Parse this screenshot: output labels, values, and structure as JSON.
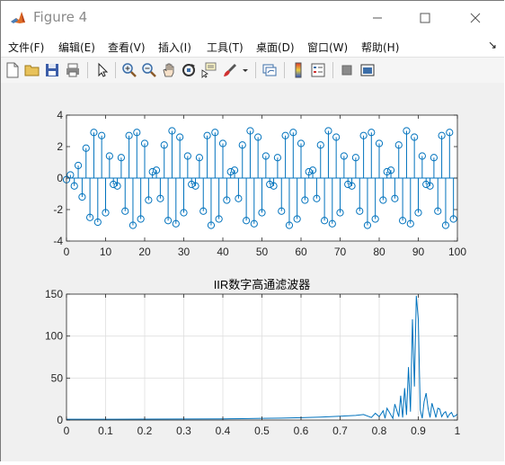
{
  "window": {
    "title": "Figure 4"
  },
  "menu": [
    "文件(F)",
    "编辑(E)",
    "查看(V)",
    "插入(I)",
    "工具(T)",
    "桌面(D)",
    "窗口(W)",
    "帮助(H)"
  ],
  "toolbar_icons": [
    "new-figure-icon",
    "open-file-icon",
    "save-icon",
    "print-icon",
    "pointer-icon",
    "zoom-in-icon",
    "zoom-out-icon",
    "pan-icon",
    "rotate-3d-icon",
    "data-cursor-icon",
    "brush-icon",
    "brush-dropdown-icon",
    "link-plot-icon",
    "colorbar-icon",
    "legend-icon",
    "hide-plot-tools-icon",
    "show-plot-tools-icon"
  ],
  "chart_data": [
    {
      "type": "stem",
      "title": "",
      "xlabel": "",
      "ylabel": "",
      "xlim": [
        0,
        100
      ],
      "ylim": [
        -4,
        4
      ],
      "xticks": [
        "0",
        "10",
        "20",
        "30",
        "40",
        "50",
        "60",
        "70",
        "80",
        "90",
        "100"
      ],
      "yticks": [
        "-4",
        "-2",
        "0",
        "2",
        "4"
      ],
      "color": "#0072bd",
      "x": [
        0,
        1,
        2,
        3,
        4,
        5,
        6,
        7,
        8,
        9,
        10,
        11,
        12,
        13,
        14,
        15,
        16,
        17,
        18,
        19,
        20,
        21,
        22,
        23,
        24,
        25,
        26,
        27,
        28,
        29,
        30,
        31,
        32,
        33,
        34,
        35,
        36,
        37,
        38,
        39,
        40,
        41,
        42,
        43,
        44,
        45,
        46,
        47,
        48,
        49,
        50,
        51,
        52,
        53,
        54,
        55,
        56,
        57,
        58,
        59,
        60,
        61,
        62,
        63,
        64,
        65,
        66,
        67,
        68,
        69,
        70,
        71,
        72,
        73,
        74,
        75,
        76,
        77,
        78,
        79,
        80,
        81,
        82,
        83,
        84,
        85,
        86,
        87,
        88,
        89,
        90,
        91,
        92,
        93,
        94,
        95,
        96,
        97,
        98,
        99
      ],
      "values": [
        -0.1,
        0.2,
        -0.5,
        0.8,
        -1.2,
        1.9,
        -2.5,
        2.9,
        -2.8,
        2.7,
        -2.2,
        1.4,
        -0.4,
        -0.5,
        1.3,
        -2.1,
        2.7,
        -3.0,
        2.9,
        -2.6,
        2.2,
        -1.4,
        0.4,
        0.5,
        -1.3,
        2.1,
        -2.7,
        3.0,
        -2.9,
        2.6,
        -2.2,
        1.4,
        -0.4,
        -0.5,
        1.3,
        -2.1,
        2.7,
        -3.0,
        2.9,
        -2.6,
        2.2,
        -1.4,
        0.4,
        0.5,
        -1.3,
        2.1,
        -2.7,
        3.0,
        -2.9,
        2.6,
        -2.2,
        1.4,
        -0.4,
        -0.5,
        1.3,
        -2.1,
        2.7,
        -3.0,
        2.9,
        -2.6,
        2.2,
        -1.4,
        0.4,
        0.5,
        -1.3,
        2.1,
        -2.7,
        3.0,
        -2.9,
        2.6,
        -2.2,
        1.4,
        -0.4,
        -0.5,
        1.3,
        -2.1,
        2.7,
        -3.0,
        2.9,
        -2.6,
        2.2,
        -1.4,
        0.4,
        0.5,
        -1.3,
        2.1,
        -2.7,
        3.0,
        -2.9,
        2.6,
        -2.2,
        1.4,
        -0.4,
        -0.5,
        1.3,
        -2.1,
        2.7,
        -3.0,
        2.9,
        -2.6
      ]
    },
    {
      "type": "line",
      "title": "IIR数字高通滤波器",
      "xlabel": "",
      "ylabel": "",
      "xlim": [
        0,
        1
      ],
      "ylim": [
        0,
        150
      ],
      "xticks": [
        "0",
        "0.1",
        "0.2",
        "0.3",
        "0.4",
        "0.5",
        "0.6",
        "0.7",
        "0.8",
        "0.9",
        "1"
      ],
      "yticks": [
        "0",
        "50",
        "100",
        "150"
      ],
      "grid": true,
      "color": "#0072bd",
      "series": [
        {
          "x": [
            0,
            0.1,
            0.2,
            0.3,
            0.4,
            0.45,
            0.5,
            0.55,
            0.6,
            0.65,
            0.7,
            0.74,
            0.76,
            0.78,
            0.79,
            0.8,
            0.81,
            0.815,
            0.82,
            0.83,
            0.835,
            0.84,
            0.85,
            0.855,
            0.86,
            0.865,
            0.87,
            0.875,
            0.88,
            0.885,
            0.89,
            0.895,
            0.9,
            0.905,
            0.91,
            0.915,
            0.92,
            0.925,
            0.93,
            0.935,
            0.94,
            0.945,
            0.95,
            0.955,
            0.96,
            0.965,
            0.97,
            0.975,
            0.98,
            0.985,
            0.99,
            0.995,
            1.0
          ],
          "values": [
            1,
            1,
            1.1,
            1.2,
            1.4,
            1.6,
            2,
            2.3,
            2.8,
            3.5,
            4.5,
            5.5,
            6.5,
            3,
            8,
            4,
            11,
            2,
            14,
            6,
            2,
            19,
            4,
            29,
            3,
            38,
            6,
            63,
            10,
            120,
            40,
            148,
            120,
            12,
            2,
            22,
            32,
            14,
            3,
            20,
            12,
            3,
            14,
            13,
            4,
            8,
            10,
            3,
            7,
            9,
            4,
            5,
            7
          ]
        }
      ]
    }
  ]
}
